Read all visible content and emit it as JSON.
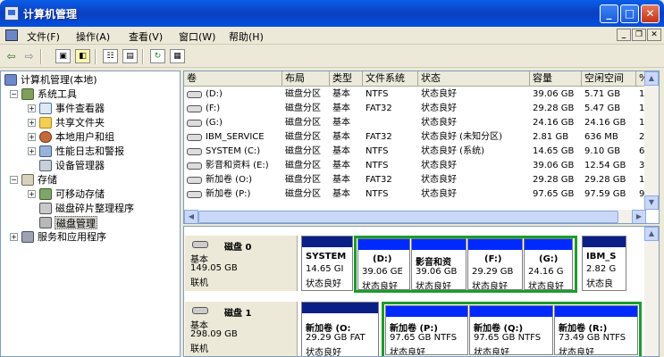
{
  "window": {
    "title": "计算机管理"
  },
  "menu": [
    "文件(F)",
    "操作(A)",
    "查看(V)",
    "窗口(W)",
    "帮助(H)"
  ],
  "mdi": {
    "min": "_",
    "restore": "❐",
    "close": "✕"
  },
  "toolbar": {
    "back": "⇦",
    "forward": "⇨"
  },
  "tree": [
    {
      "label": "计算机管理(本地)",
      "icon": "computer-icon"
    },
    {
      "label": "系统工具",
      "icon": "tools-icon"
    },
    {
      "label": "事件查看器",
      "icon": "event-viewer-icon"
    },
    {
      "label": "共享文件夹",
      "icon": "folder-icon"
    },
    {
      "label": "本地用户和组",
      "icon": "users-icon"
    },
    {
      "label": "性能日志和警报",
      "icon": "performance-icon"
    },
    {
      "label": "设备管理器",
      "icon": "device-manager-icon"
    },
    {
      "label": "存储",
      "icon": "storage-icon"
    },
    {
      "label": "可移动存储",
      "icon": "removable-storage-icon"
    },
    {
      "label": "磁盘碎片整理程序",
      "icon": "defrag-icon"
    },
    {
      "label": "磁盘管理",
      "icon": "disk-management-icon"
    },
    {
      "label": "服务和应用程序",
      "icon": "services-icon"
    }
  ],
  "columns": [
    "卷",
    "布局",
    "类型",
    "文件系统",
    "状态",
    "容量",
    "空闲空间",
    "%"
  ],
  "volumes": [
    {
      "name": "(D:)",
      "layout": "磁盘分区",
      "type": "基本",
      "fs": "NTFS",
      "status": "状态良好",
      "capacity": "39.06 GB",
      "free": "5.71 GB",
      "pct": "1"
    },
    {
      "name": "(F:)",
      "layout": "磁盘分区",
      "type": "基本",
      "fs": "FAT32",
      "status": "状态良好",
      "capacity": "29.28 GB",
      "free": "5.47 GB",
      "pct": "1"
    },
    {
      "name": "(G:)",
      "layout": "磁盘分区",
      "type": "基本",
      "fs": "",
      "status": "状态良好",
      "capacity": "24.16 GB",
      "free": "24.16 GB",
      "pct": "1"
    },
    {
      "name": "IBM_SERVICE",
      "layout": "磁盘分区",
      "type": "基本",
      "fs": "FAT32",
      "status": "状态良好 (未知分区)",
      "capacity": "2.81 GB",
      "free": "636 MB",
      "pct": "2"
    },
    {
      "name": "SYSTEM (C:)",
      "layout": "磁盘分区",
      "type": "基本",
      "fs": "NTFS",
      "status": "状态良好 (系统)",
      "capacity": "14.65 GB",
      "free": "9.10 GB",
      "pct": "6"
    },
    {
      "name": "影音和资料 (E:)",
      "layout": "磁盘分区",
      "type": "基本",
      "fs": "NTFS",
      "status": "状态良好",
      "capacity": "39.06 GB",
      "free": "12.54 GB",
      "pct": "3"
    },
    {
      "name": "新加卷 (O:)",
      "layout": "磁盘分区",
      "type": "基本",
      "fs": "FAT32",
      "status": "状态良好",
      "capacity": "29.28 GB",
      "free": "29.28 GB",
      "pct": "1"
    },
    {
      "name": "新加卷 (P:)",
      "layout": "磁盘分区",
      "type": "基本",
      "fs": "NTFS",
      "status": "状态良好",
      "capacity": "97.65 GB",
      "free": "97.59 GB",
      "pct": "9"
    }
  ],
  "disk0": {
    "name": "磁盘 0",
    "type": "基本",
    "size": "149.05 GB",
    "status": "联机",
    "partitions": [
      {
        "name": "SYSTEM",
        "size": "14.65 GI",
        "status": "状态良好"
      },
      {
        "name": "(D:)",
        "size": "39.06 GE",
        "status": "状态良好"
      },
      {
        "name": "影音和资",
        "size": "39.06 GB",
        "status": "状态良好"
      },
      {
        "name": "(F:)",
        "size": "29.29 GB",
        "status": "状态良好"
      },
      {
        "name": "(G:)",
        "size": "24.16 G",
        "status": "状态良好"
      },
      {
        "name": "IBM_S",
        "size": "2.82 G",
        "status": "状态良"
      }
    ]
  },
  "disk1": {
    "name": "磁盘 1",
    "type": "基本",
    "size": "298.09 GB",
    "status": "联机",
    "partitions": [
      {
        "name": "新加卷  (O:",
        "size": "29.29 GB FAT",
        "status": "状态良好"
      },
      {
        "name": "新加卷  (P:)",
        "size": "97.65 GB NTFS",
        "status": "状态良好"
      },
      {
        "name": "新加卷  (Q:)",
        "size": "97.65 GB NTFS",
        "status": "状态良好"
      },
      {
        "name": "新加卷  (R:)",
        "size": "73.49 GB NTFS",
        "status": "状态良好"
      }
    ]
  }
}
